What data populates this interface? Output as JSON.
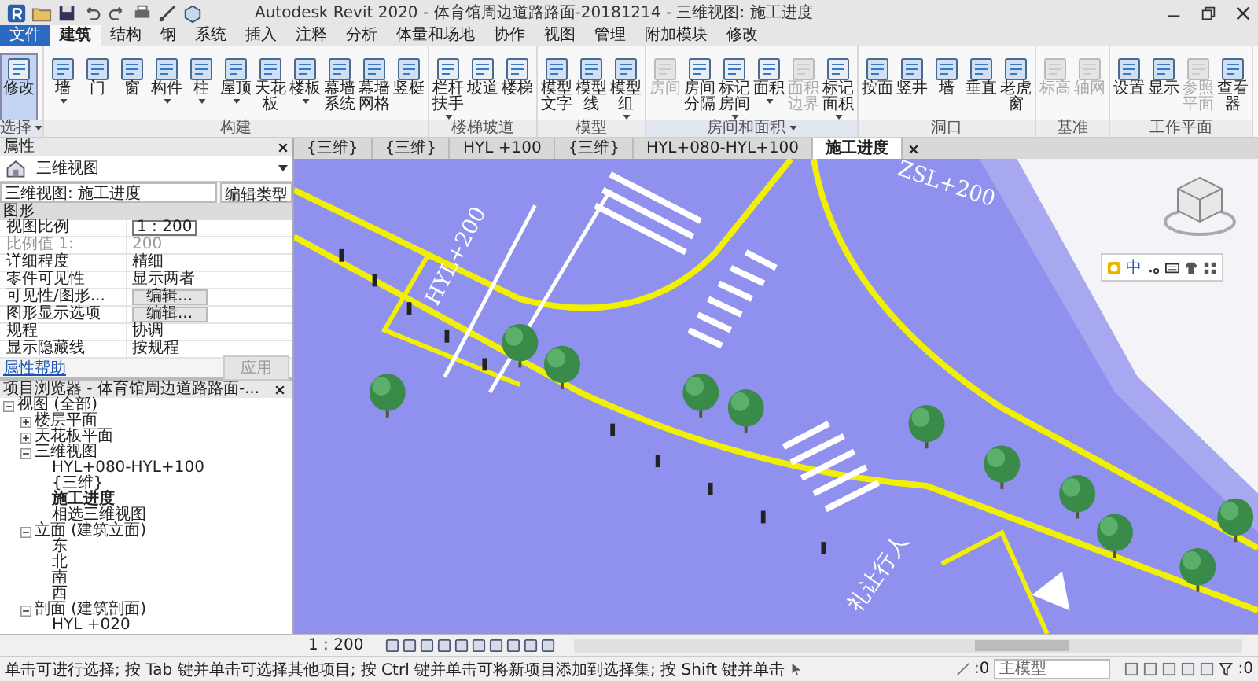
{
  "window": {
    "title": "Autodesk Revit 2020 - 体育馆周边道路路面-20181214 - 三维视图: 施工进度"
  },
  "ribbon_tabs": [
    {
      "label": "文件",
      "kind": "file",
      "selected": false
    },
    {
      "label": "建筑",
      "kind": "tab",
      "selected": true
    },
    {
      "label": "结构",
      "kind": "tab",
      "selected": false
    },
    {
      "label": "钢",
      "kind": "tab",
      "selected": false
    },
    {
      "label": "系统",
      "kind": "tab",
      "selected": false
    },
    {
      "label": "插入",
      "kind": "tab",
      "selected": false
    },
    {
      "label": "注释",
      "kind": "tab",
      "selected": false
    },
    {
      "label": "分析",
      "kind": "tab",
      "selected": false
    },
    {
      "label": "体量和场地",
      "kind": "tab",
      "selected": false
    },
    {
      "label": "协作",
      "kind": "tab",
      "selected": false
    },
    {
      "label": "视图",
      "kind": "tab",
      "selected": false
    },
    {
      "label": "管理",
      "kind": "tab",
      "selected": false
    },
    {
      "label": "附加模块",
      "kind": "tab",
      "selected": false
    },
    {
      "label": "修改",
      "kind": "tab",
      "selected": false
    }
  ],
  "ribbon_groups": [
    {
      "label": "选择",
      "dropdown": true,
      "tools": [
        {
          "label": "修改",
          "dropdown": false,
          "disabled": false,
          "selected": true
        }
      ]
    },
    {
      "label": "构建",
      "dropdown": false,
      "tools": [
        {
          "label": "墙",
          "dropdown": true,
          "disabled": false,
          "selected": false
        },
        {
          "label": "门",
          "dropdown": false,
          "disabled": false,
          "selected": false
        },
        {
          "label": "窗",
          "dropdown": false,
          "disabled": false,
          "selected": false
        },
        {
          "label": "构件",
          "dropdown": true,
          "disabled": false,
          "selected": false
        },
        {
          "label": "柱",
          "dropdown": true,
          "disabled": false,
          "selected": false
        },
        {
          "label": "屋顶",
          "dropdown": true,
          "disabled": false,
          "selected": false
        },
        {
          "label": "天花板",
          "dropdown": false,
          "disabled": false,
          "selected": false
        },
        {
          "label": "楼板",
          "dropdown": true,
          "disabled": false,
          "selected": false
        },
        {
          "label": "幕墙系统",
          "dropdown": false,
          "disabled": false,
          "selected": false
        },
        {
          "label": "幕墙网格",
          "dropdown": false,
          "disabled": false,
          "selected": false
        },
        {
          "label": "竖梃",
          "dropdown": false,
          "disabled": false,
          "selected": false
        }
      ]
    },
    {
      "label": "楼梯坡道",
      "dropdown": false,
      "tools": [
        {
          "label": "栏杆扶手",
          "dropdown": true,
          "disabled": false,
          "selected": false
        },
        {
          "label": "坡道",
          "dropdown": false,
          "disabled": false,
          "selected": false
        },
        {
          "label": "楼梯",
          "dropdown": false,
          "disabled": false,
          "selected": false
        }
      ]
    },
    {
      "label": "模型",
      "dropdown": false,
      "tools": [
        {
          "label": "模型文字",
          "dropdown": false,
          "disabled": false,
          "selected": false
        },
        {
          "label": "模型线",
          "dropdown": false,
          "disabled": false,
          "selected": false
        },
        {
          "label": "模型组",
          "dropdown": true,
          "disabled": false,
          "selected": false
        }
      ]
    },
    {
      "label": "房间和面积",
      "dropdown": true,
      "tools": [
        {
          "label": "房间",
          "dropdown": false,
          "disabled": true,
          "selected": false
        },
        {
          "label": "房间分隔",
          "dropdown": false,
          "disabled": false,
          "selected": false
        },
        {
          "label": "标记房间",
          "dropdown": true,
          "disabled": false,
          "selected": false
        },
        {
          "label": "面积",
          "dropdown": true,
          "disabled": false,
          "selected": false
        },
        {
          "label": "面积边界",
          "dropdown": false,
          "disabled": true,
          "selected": false
        },
        {
          "label": "标记面积",
          "dropdown": true,
          "disabled": false,
          "selected": false
        }
      ]
    },
    {
      "label": "洞口",
      "dropdown": false,
      "tools": [
        {
          "label": "按面",
          "dropdown": false,
          "disabled": false,
          "selected": false
        },
        {
          "label": "竖井",
          "dropdown": false,
          "disabled": false,
          "selected": false
        },
        {
          "label": "墙",
          "dropdown": false,
          "disabled": false,
          "selected": false
        },
        {
          "label": "垂直",
          "dropdown": false,
          "disabled": false,
          "selected": false
        },
        {
          "label": "老虎窗",
          "dropdown": false,
          "disabled": false,
          "selected": false
        }
      ]
    },
    {
      "label": "基准",
      "dropdown": false,
      "tools": [
        {
          "label": "标高",
          "dropdown": false,
          "disabled": true,
          "selected": false
        },
        {
          "label": "轴网",
          "dropdown": false,
          "disabled": true,
          "selected": false
        }
      ]
    },
    {
      "label": "工作平面",
      "dropdown": false,
      "tools": [
        {
          "label": "设置",
          "dropdown": false,
          "disabled": false,
          "selected": false
        },
        {
          "label": "显示",
          "dropdown": false,
          "disabled": false,
          "selected": false
        },
        {
          "label": "参照平面",
          "dropdown": false,
          "disabled": true,
          "selected": false
        },
        {
          "label": "查看器",
          "dropdown": false,
          "disabled": false,
          "selected": false
        }
      ]
    }
  ],
  "properties": {
    "title": "属性",
    "type_name": "三维视图",
    "instance": "三维视图: 施工进度",
    "edit_type": "编辑类型",
    "group": "图形",
    "rows": [
      {
        "name": "视图比例",
        "value": "1 : 200",
        "kind": "field",
        "disabled": false
      },
      {
        "name": "比例值 1:",
        "value": "200",
        "kind": "text",
        "disabled": true
      },
      {
        "name": "详细程度",
        "value": "精细",
        "kind": "text",
        "disabled": false
      },
      {
        "name": "零件可见性",
        "value": "显示两者",
        "kind": "text",
        "disabled": false
      },
      {
        "name": "可见性/图形...",
        "value": "编辑...",
        "kind": "button",
        "disabled": false
      },
      {
        "name": "图形显示选项",
        "value": "编辑...",
        "kind": "button",
        "disabled": false
      },
      {
        "name": "规程",
        "value": "协调",
        "kind": "text",
        "disabled": false
      },
      {
        "name": "显示隐藏线",
        "value": "按规程",
        "kind": "text",
        "disabled": false
      }
    ],
    "help": "属性帮助",
    "apply": {
      "label": "应用",
      "disabled": true
    }
  },
  "browser": {
    "title": "项目浏览器 - 体育馆周边道路路面-...",
    "tree": [
      {
        "label": "视图 (全部)",
        "expanded": true,
        "selected": false,
        "children": [
          {
            "label": "楼层平面",
            "expanded": false,
            "selected": false
          },
          {
            "label": "天花板平面",
            "expanded": false,
            "selected": false
          },
          {
            "label": "三维视图",
            "expanded": true,
            "selected": false,
            "children": [
              {
                "label": "HYL+080-HYL+100",
                "selected": false
              },
              {
                "label": "{三维}",
                "selected": false
              },
              {
                "label": "施工进度",
                "selected": true
              },
              {
                "label": "相选三维视图",
                "selected": false
              }
            ]
          },
          {
            "label": "立面 (建筑立面)",
            "expanded": true,
            "selected": false,
            "children": [
              {
                "label": "东",
                "selected": false
              },
              {
                "label": "北",
                "selected": false
              },
              {
                "label": "南",
                "selected": false
              },
              {
                "label": "西",
                "selected": false
              }
            ]
          },
          {
            "label": "剖面 (建筑剖面)",
            "expanded": true,
            "selected": false,
            "children": [
              {
                "label": "HYL +020",
                "selected": false
              }
            ]
          }
        ]
      }
    ]
  },
  "view_tabs": [
    {
      "label": "{三维}",
      "selected": false
    },
    {
      "label": "{三维}",
      "selected": false
    },
    {
      "label": "HYL +100",
      "selected": false
    },
    {
      "label": "{三维}",
      "selected": false
    },
    {
      "label": "HYL+080-HYL+100",
      "selected": false
    },
    {
      "label": "施工进度",
      "selected": true
    }
  ],
  "viewport": {
    "labels": [
      "HYL+200",
      "ZSL+200",
      "礼让行人"
    ],
    "ime_mode": "中"
  },
  "view_control": {
    "scale": "1 : 200"
  },
  "status_bar": {
    "message": "单击可进行选择; 按 Tab 键并单击可选择其他项目; 按 Ctrl 键并单击可将新项目添加到选择集; 按 Shift 键并单击",
    "count": ":0",
    "model": "主模型",
    "filter_count": ":0"
  }
}
